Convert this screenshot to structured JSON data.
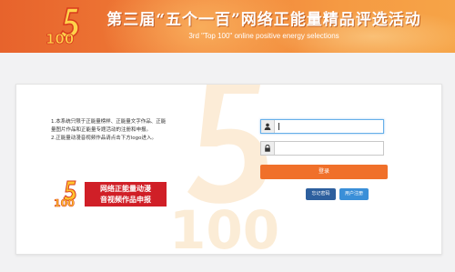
{
  "header": {
    "title": "第三届“五个一百”网络正能量精品评选活动",
    "subtitle": "3rd \"Top 100\" online positive energy selections",
    "logo_text": "100"
  },
  "info": {
    "line1": "1.本系统只限于正能量榜样、正能量文字作品、正能量图片作品和正能量专题活动的注册和申报。",
    "line2": "2.正能量动漫音视频作品请点击下方logo进入。"
  },
  "promo": {
    "line1": "网络正能量动漫",
    "line2": "音视频作品申报"
  },
  "form": {
    "username_value": "",
    "password_value": "",
    "login_label": "登录",
    "forgot_label": "忘记密码",
    "register_label": "用户注册"
  },
  "colors": {
    "accent": "#f0702a",
    "forgot_btn": "#2d5f9e",
    "register_btn": "#3a8fd8",
    "promo_red": "#d01f27"
  },
  "icons": {
    "username": "user-icon",
    "password": "lock-icon"
  }
}
